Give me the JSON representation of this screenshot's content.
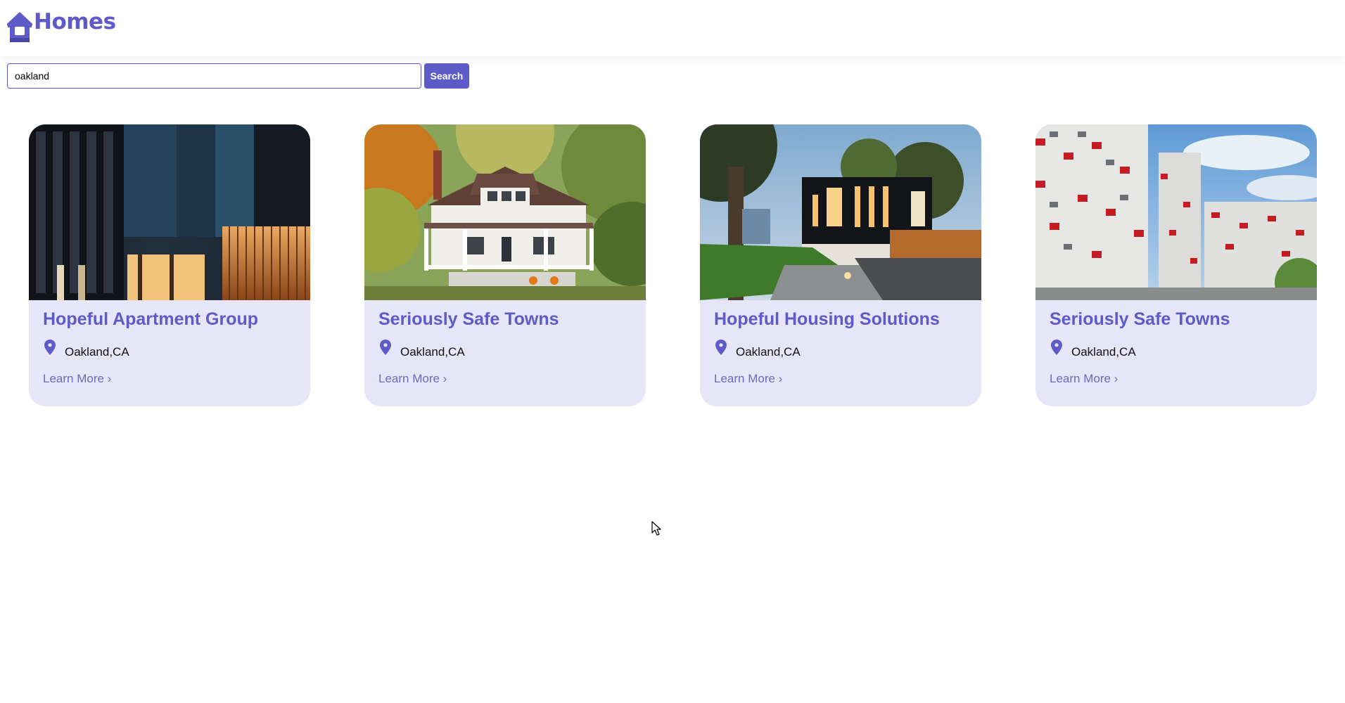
{
  "app": {
    "title": "Homes",
    "logo_icon": "house-icon",
    "brand_color": "#5e5ac8"
  },
  "search": {
    "value": "oakland",
    "button_label": "Search"
  },
  "listings": [
    {
      "title": "Hopeful Apartment Group",
      "location": "Oakland,CA",
      "link_label": "Learn More ›",
      "image": "modern-dark-apartment-photo"
    },
    {
      "title": "Seriously Safe Towns",
      "location": "Oakland,CA",
      "link_label": "Learn More ›",
      "image": "white-porch-house-photo"
    },
    {
      "title": "Hopeful Housing Solutions",
      "location": "Oakland,CA",
      "link_label": "Learn More ›",
      "image": "modern-house-at-dusk-photo"
    },
    {
      "title": "Seriously Safe Towns",
      "location": "Oakland,CA",
      "link_label": "Learn More ›",
      "image": "red-white-towers-photo"
    }
  ],
  "icons": {
    "location": "map-pin-icon"
  }
}
